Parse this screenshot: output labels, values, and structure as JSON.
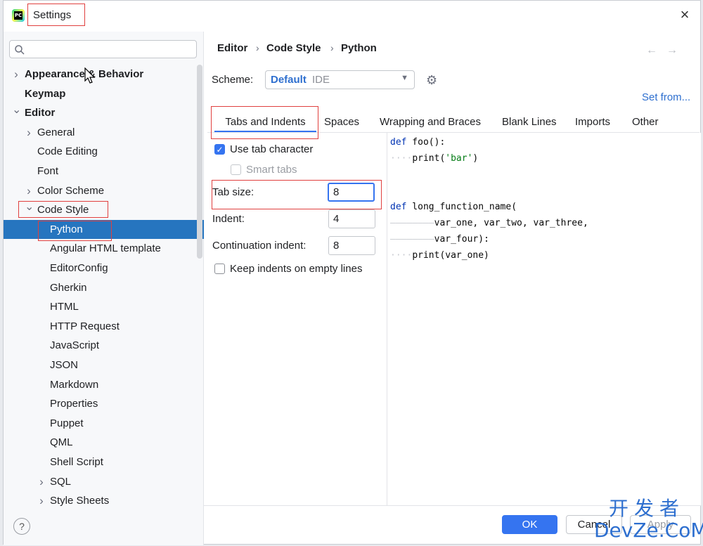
{
  "window": {
    "title": "Settings"
  },
  "sidebar": {
    "search_placeholder": "",
    "items": [
      {
        "label": "Appearance & Behavior",
        "level": 0,
        "expandable": true,
        "expanded": false,
        "bold": true
      },
      {
        "label": "Keymap",
        "level": 0,
        "expandable": false,
        "bold": true
      },
      {
        "label": "Editor",
        "level": 0,
        "expandable": true,
        "expanded": true,
        "bold": true
      },
      {
        "label": "General",
        "level": 1,
        "expandable": true,
        "expanded": false
      },
      {
        "label": "Code Editing",
        "level": 1,
        "expandable": false
      },
      {
        "label": "Font",
        "level": 1,
        "expandable": false
      },
      {
        "label": "Color Scheme",
        "level": 1,
        "expandable": true,
        "expanded": false
      },
      {
        "label": "Code Style",
        "level": 1,
        "expandable": true,
        "expanded": true
      },
      {
        "label": "Python",
        "level": 2,
        "expandable": false,
        "selected": true
      },
      {
        "label": "Angular HTML template",
        "level": 2,
        "expandable": false
      },
      {
        "label": "EditorConfig",
        "level": 2,
        "expandable": false
      },
      {
        "label": "Gherkin",
        "level": 2,
        "expandable": false
      },
      {
        "label": "HTML",
        "level": 2,
        "expandable": false
      },
      {
        "label": "HTTP Request",
        "level": 2,
        "expandable": false
      },
      {
        "label": "JavaScript",
        "level": 2,
        "expandable": false
      },
      {
        "label": "JSON",
        "level": 2,
        "expandable": false
      },
      {
        "label": "Markdown",
        "level": 2,
        "expandable": false
      },
      {
        "label": "Properties",
        "level": 2,
        "expandable": false
      },
      {
        "label": "Puppet",
        "level": 2,
        "expandable": false
      },
      {
        "label": "QML",
        "level": 2,
        "expandable": false
      },
      {
        "label": "Shell Script",
        "level": 2,
        "expandable": false
      },
      {
        "label": "SQL",
        "level": 2,
        "expandable": true,
        "expanded": false
      },
      {
        "label": "Style Sheets",
        "level": 2,
        "expandable": true,
        "expanded": false
      }
    ],
    "help_label": "?"
  },
  "breadcrumb": [
    "Editor",
    "Code Style",
    "Python"
  ],
  "scheme": {
    "label": "Scheme:",
    "value": "Default",
    "type": "IDE"
  },
  "set_from": "Set from...",
  "tabs": [
    {
      "label": "Tabs and Indents",
      "active": true
    },
    {
      "label": "Spaces"
    },
    {
      "label": "Wrapping and Braces"
    },
    {
      "label": "Blank Lines"
    },
    {
      "label": "Imports"
    },
    {
      "label": "Other"
    }
  ],
  "options": {
    "use_tab_character": {
      "label": "Use tab character",
      "checked": true
    },
    "smart_tabs": {
      "label": "Smart tabs",
      "checked": false,
      "enabled": false
    },
    "tab_size": {
      "label": "Tab size:",
      "value": "8"
    },
    "indent": {
      "label": "Indent:",
      "value": "4"
    },
    "continuation_indent": {
      "label": "Continuation indent:",
      "value": "8"
    },
    "keep_indents": {
      "label": "Keep indents on empty lines",
      "checked": false
    }
  },
  "code_preview": {
    "kw_def": "def",
    "l1": " foo():",
    "l2_ws": "····",
    "l2a": "print(",
    "l2_str": "'bar'",
    "l2b": ")",
    "l5": " long_function_name(",
    "l6_ws": "————————",
    "l6": "var_one, var_two, var_three,",
    "l7_ws": "————————",
    "l7": "var_four):",
    "l8_ws": "····",
    "l8": "print(var_one)"
  },
  "buttons": {
    "ok": "OK",
    "cancel": "Cancel",
    "apply": "Apply"
  },
  "watermark": {
    "line1": "开发者",
    "line2": "DevZe.CoM"
  },
  "colors": {
    "accent": "#3574f0",
    "selection": "#2675bf",
    "highlight_box": "#e0403f"
  }
}
